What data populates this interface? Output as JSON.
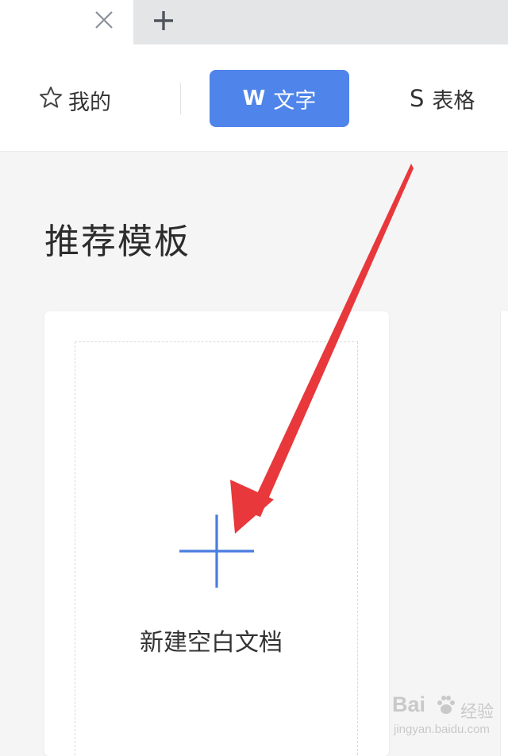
{
  "tabs": {
    "close_icon": "close-icon",
    "add_icon": "plus-icon"
  },
  "categories": {
    "mine": {
      "label": "我的",
      "icon": "star-icon"
    },
    "writer": {
      "label": "文字",
      "glyph": "W",
      "active": true,
      "color": "#4f85ea"
    },
    "sheet": {
      "label": "表格",
      "glyph": "S"
    }
  },
  "section": {
    "title": "推荐模板"
  },
  "template_card": {
    "label": "新建空白文档",
    "icon": "plus-icon",
    "accent": "#4a7de0"
  },
  "annotation": {
    "arrow_color": "#e8383b"
  },
  "watermark": {
    "logo": "Bai",
    "cn": "经验",
    "url": "jingyan.baidu.com"
  }
}
